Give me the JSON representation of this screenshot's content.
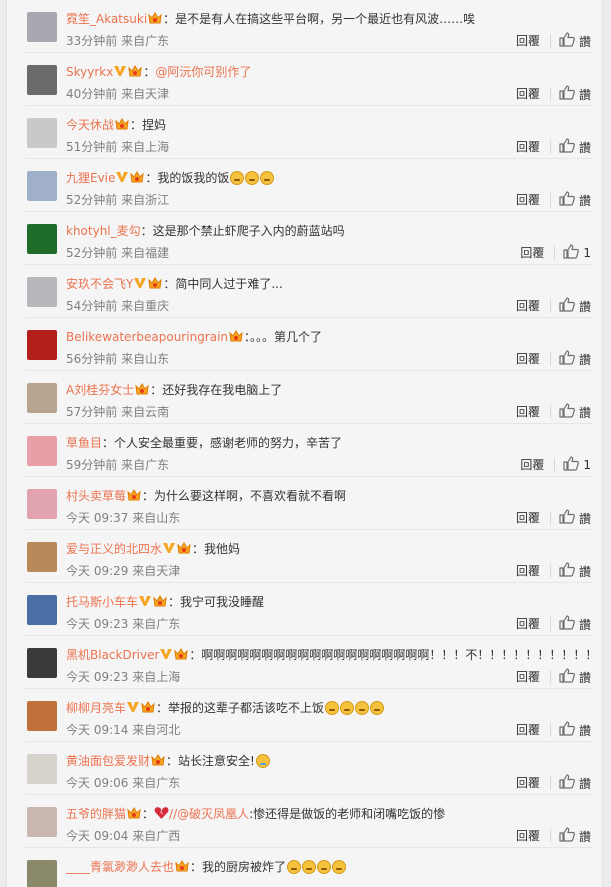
{
  "labels": {
    "reply": "回覆",
    "like": "讚"
  },
  "colors": {
    "username": "#eb7350",
    "meta": "#808080",
    "text": "#333333"
  },
  "comments": [
    {
      "username": "霓笙_Akatsuki",
      "badges": [
        "weibo-member-icon"
      ],
      "text": "是不是有人在搞这些平台啊，另一个最近也有风波……唉",
      "emojis": [],
      "time": "33分钟前",
      "location": "来自广东",
      "like_label": "讚",
      "avatar_color": "#a8a8b0"
    },
    {
      "username": "Skyyrkx",
      "badges": [
        "verified-v-icon",
        "weibo-member-icon"
      ],
      "mention": "@阿沅你可别作了",
      "text": "",
      "emojis": [],
      "time": "40分钟前",
      "location": "来自天津",
      "like_label": "讚",
      "avatar_color": "#6b6b6b"
    },
    {
      "username": "今天休战",
      "badges": [
        "weibo-member-icon"
      ],
      "text": "捏妈",
      "emojis": [],
      "time": "51分钟前",
      "location": "来自上海",
      "like_label": "讚",
      "avatar_color": "#c9c9c9"
    },
    {
      "username": "九狸Evie",
      "badges": [
        "verified-v-icon",
        "weibo-member-icon"
      ],
      "text": "我的饭我的饭",
      "emojis": [
        "cry-laugh",
        "cry-laugh",
        "cry-laugh"
      ],
      "time": "52分钟前",
      "location": "来自浙江",
      "like_label": "讚",
      "avatar_color": "#9fb0c8"
    },
    {
      "username": "khotyhl_麦勾",
      "badges": [],
      "text": "这是那个禁止虾爬子入内的蔚蓝站吗",
      "emojis": [],
      "time": "52分钟前",
      "location": "来自福建",
      "like_label": "1",
      "avatar_color": "#1f6b2a"
    },
    {
      "username": "安玖不会飞Y",
      "badges": [
        "verified-v-icon",
        "weibo-member-icon"
      ],
      "text": "简中同人过于难了...",
      "emojis": [],
      "time": "54分钟前",
      "location": "来自重庆",
      "like_label": "讚",
      "avatar_color": "#b6b6bb"
    },
    {
      "username": "Belikewaterbeapouringrain",
      "badges": [
        "weibo-member-icon"
      ],
      "text": "。。。第几个了",
      "emojis": [],
      "time": "56分钟前",
      "location": "来自山东",
      "like_label": "讚",
      "avatar_color": "#b3201c"
    },
    {
      "username": "A刘桂芬女士",
      "badges": [
        "weibo-member-icon"
      ],
      "text": "还好我存在我电脑上了",
      "emojis": [],
      "time": "57分钟前",
      "location": "来自云南",
      "like_label": "讚",
      "avatar_color": "#b7a590"
    },
    {
      "username": "草鱼目",
      "badges": [],
      "text": "个人安全最重要，感谢老师的努力，辛苦了",
      "emojis": [],
      "time": "59分钟前",
      "location": "来自广东",
      "like_label": "1",
      "avatar_color": "#e8a0a8"
    },
    {
      "username": "村头卖草莓",
      "badges": [
        "weibo-member-icon"
      ],
      "text": "为什么要这样啊，不喜欢看就不看啊",
      "emojis": [],
      "time": "今天 09:37",
      "location": "来自山东",
      "like_label": "讚",
      "avatar_color": "#e2a3b0"
    },
    {
      "username": "爱与正义的北四水",
      "badges": [
        "verified-v-icon",
        "weibo-member-icon"
      ],
      "text": "我他妈",
      "emojis": [],
      "time": "今天 09:29",
      "location": "来自天津",
      "like_label": "讚",
      "avatar_color": "#b88a5a"
    },
    {
      "username": "托马斯小车车",
      "badges": [
        "verified-v-icon",
        "weibo-member-icon"
      ],
      "text": "我宁可我没睡醒",
      "emojis": [],
      "time": "今天 09:23",
      "location": "来自广东",
      "like_label": "讚",
      "avatar_color": "#4a6fa5"
    },
    {
      "username": "黑机BlackDriver",
      "badges": [
        "verified-v-icon",
        "weibo-member-icon"
      ],
      "text": "啊啊啊啊啊啊啊啊啊啊啊啊啊啊啊啊啊啊啊！！！不！！！！！！！！！！",
      "emojis": [],
      "time": "今天 09:23",
      "location": "来自上海",
      "like_label": "讚",
      "avatar_color": "#3a3a3a"
    },
    {
      "username": "柳柳月亮车",
      "badges": [
        "verified-v-icon",
        "weibo-member-icon"
      ],
      "text": "举报的这辈子都活该吃不上饭",
      "emojis": [
        "cry-laugh",
        "cry-laugh",
        "cry-laugh",
        "cry-laugh"
      ],
      "time": "今天 09:14",
      "location": "来自河北",
      "like_label": "讚",
      "avatar_color": "#c0703a"
    },
    {
      "username": "黄油面包爱发财",
      "badges": [
        "weibo-member-icon"
      ],
      "text": "站长注意安全!",
      "emojis": [
        "sad"
      ],
      "time": "今天 09:06",
      "location": "来自广东",
      "like_label": "讚",
      "avatar_color": "#d6d2cc"
    },
    {
      "username": "五爷的胖猫",
      "badges": [
        "weibo-member-icon"
      ],
      "broken_heart": true,
      "text_prefix": "//",
      "mention": "@破灭凤凰人",
      "text": ":惨还得是做饭的老师和闭嘴吃饭的惨",
      "emojis": [],
      "time": "今天 09:04",
      "location": "来自广西",
      "like_label": "讚",
      "avatar_color": "#c9b8b0"
    },
    {
      "username": "____青氯渺渺人去也",
      "badges": [
        "weibo-member-icon"
      ],
      "text": "我的厨房被炸了",
      "emojis": [
        "cry-laugh",
        "cry-laugh",
        "cry-laugh",
        "cry-laugh"
      ],
      "time": "",
      "location": "",
      "like_label": "讚",
      "avatar_color": "#8a8a6a"
    }
  ]
}
